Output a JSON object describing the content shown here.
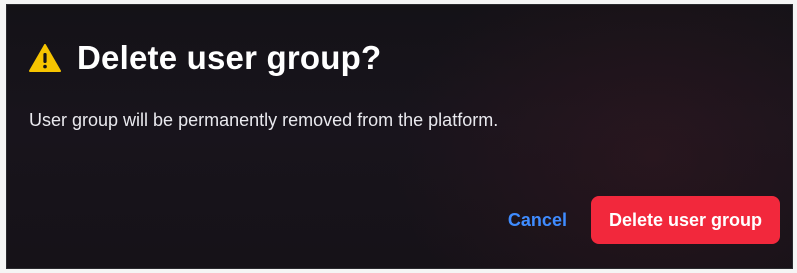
{
  "dialog": {
    "title": "Delete user group?",
    "message": "User group will be permanently removed from the platform.",
    "icon": "warning-triangle-icon",
    "cancel_label": "Cancel",
    "confirm_label": "Delete user group"
  },
  "colors": {
    "background": "#141217",
    "warning": "#f6c400",
    "link": "#3f8cff",
    "danger": "#f2283c",
    "text": "#ffffff"
  }
}
